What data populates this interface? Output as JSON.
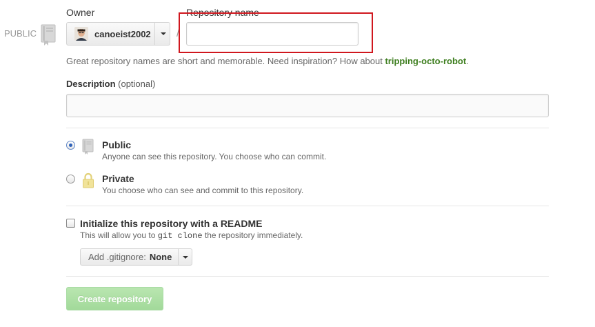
{
  "visibility_badge": {
    "label": "PUBLIC",
    "icon": "repo-book-icon"
  },
  "owner": {
    "label": "Owner",
    "selected": "canoeist2002",
    "avatar_icon": "user-avatar"
  },
  "separator": "/",
  "repository_name": {
    "label": "Repository name",
    "value": "",
    "placeholder": ""
  },
  "name_hint": {
    "text": "Great repository names are short and memorable. Need inspiration? How about ",
    "suggestion": "tripping-octo-robot",
    "end": "."
  },
  "description": {
    "label": "Description",
    "optional": "(optional)",
    "value": ""
  },
  "visibility_options": [
    {
      "title": "Public",
      "description": "Anyone can see this repository. You choose who can commit.",
      "checked": true,
      "icon": "repo-book-icon"
    },
    {
      "title": "Private",
      "description": "You choose who can see and commit to this repository.",
      "checked": false,
      "icon": "lock-icon"
    }
  ],
  "initialize": {
    "title": "Initialize this repository with a README",
    "desc_before": "This will allow you to ",
    "desc_code": "git clone",
    "desc_after": " the repository immediately.",
    "checked": false
  },
  "gitignore": {
    "label": "Add .gitignore:",
    "value": "None"
  },
  "create_button": {
    "label": "Create repository",
    "enabled": false
  },
  "colors": {
    "highlight": "#d0171e",
    "suggestion": "#3c7d1d",
    "create_button": "#a2d99a"
  }
}
